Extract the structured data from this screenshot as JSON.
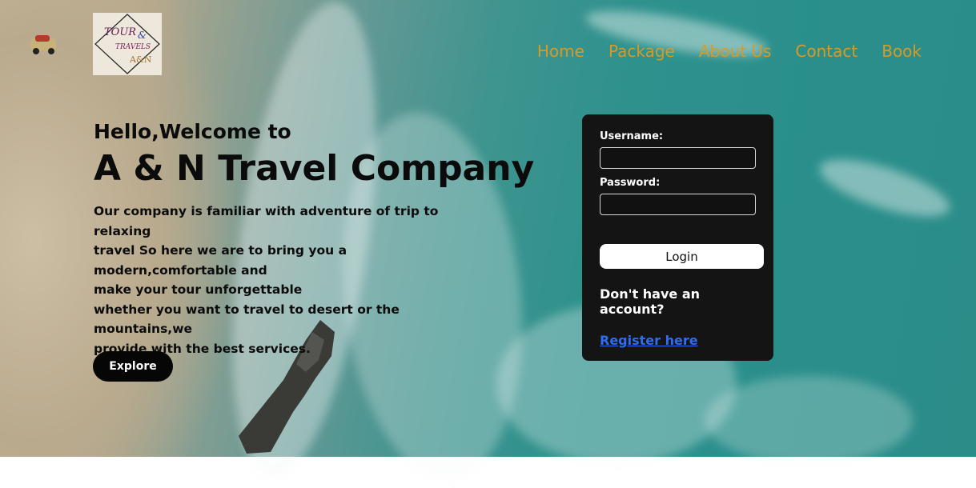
{
  "logo": {
    "lines": [
      "TOUR",
      "&",
      "TRAVELS",
      "A&N"
    ]
  },
  "nav": {
    "items": [
      "Home",
      "Package",
      "About Us",
      "Contact",
      "Book"
    ]
  },
  "hero": {
    "greeting": "Hello,Welcome to",
    "company": "A & N Travel Company",
    "description_lines": [
      "Our company is familiar with adventure of trip to relaxing",
      "travel So here we are to bring you a modern,comfortable and",
      "make your tour unforgettable",
      "whether you want to travel to desert or the mountains,we",
      "provide with the best services."
    ],
    "explore_label": "Explore"
  },
  "login": {
    "username_label": "Username:",
    "username_value": "",
    "password_label": "Password:",
    "password_value": "",
    "login_label": "Login",
    "no_account_text": "Don't have an account?",
    "register_link": "Register here"
  },
  "colors": {
    "nav_text": "#d89a27",
    "login_panel": "#141414",
    "register_link": "#2e6cf2",
    "explore_button": "#060606"
  }
}
